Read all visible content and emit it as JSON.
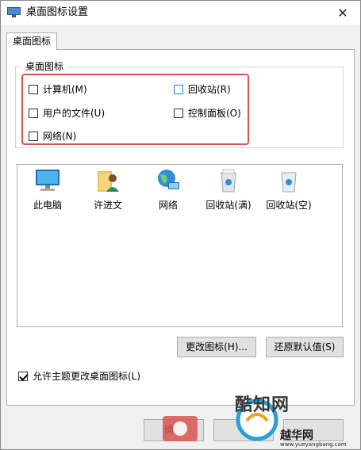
{
  "window": {
    "title": "桌面图标设置",
    "close_glyph": "✕"
  },
  "tab": {
    "label": "桌面图标"
  },
  "group": {
    "title": "桌面图标",
    "checkboxes": [
      {
        "label": "计算机(M)",
        "checked": false
      },
      {
        "label": "回收站(R)",
        "checked": false
      },
      {
        "label": "用户的文件(U)",
        "checked": false
      },
      {
        "label": "控制面板(O)",
        "checked": false
      },
      {
        "label": "网络(N)",
        "checked": false
      }
    ]
  },
  "icons": [
    {
      "label": "此电脑",
      "icon": "computer-icon"
    },
    {
      "label": "许进文",
      "icon": "user-folder-icon"
    },
    {
      "label": "网络",
      "icon": "network-icon"
    },
    {
      "label": "回收站(满)",
      "icon": "recycle-bin-full-icon"
    },
    {
      "label": "回收站(空)",
      "icon": "recycle-bin-empty-icon"
    }
  ],
  "buttons": {
    "change_icon": "更改图标(H)...",
    "restore_default": "还原默认值(S)",
    "ok": "确定",
    "cancel": "",
    "apply": ""
  },
  "allow_theme": {
    "label": "允许主题更改桌面图标(L)",
    "checked": true
  },
  "watermark": {
    "brand": "酷知网",
    "site_name": "越华网",
    "url": "www.yueyangbang.com"
  },
  "colors": {
    "highlight_border": "#d9534f",
    "accent": "#2b78d6"
  }
}
